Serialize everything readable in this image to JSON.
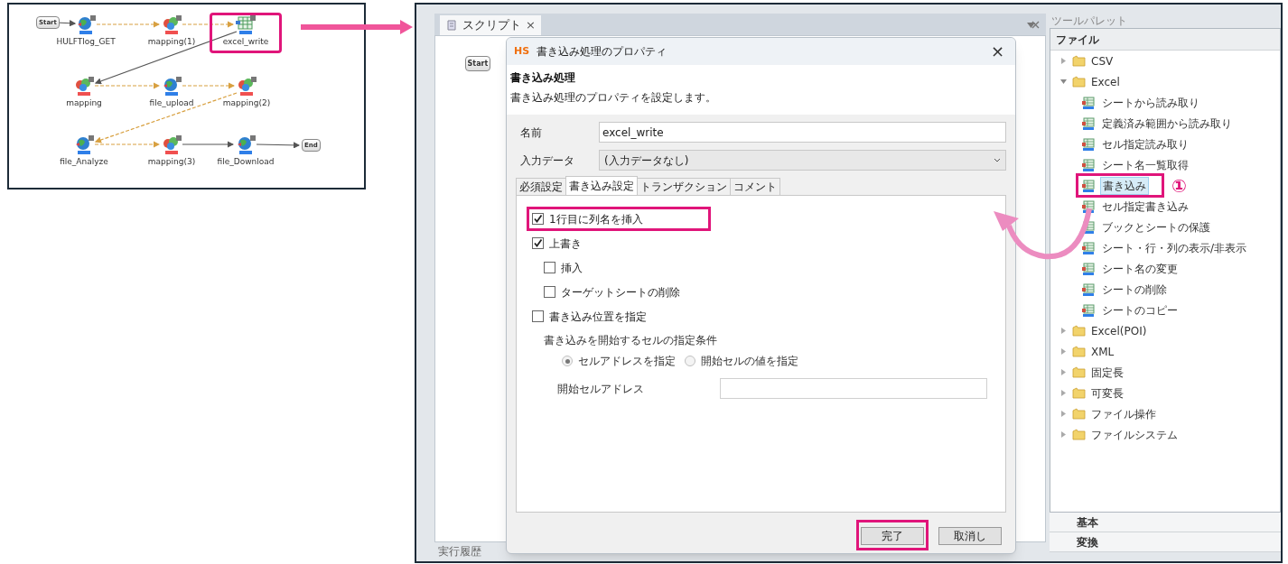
{
  "diagram": {
    "nodes": [
      {
        "label": "Start",
        "kind": "start",
        "highlighted": false
      },
      {
        "label": "HULFTlog_GET",
        "kind": "rest",
        "highlighted": false
      },
      {
        "label": "mapping(1)",
        "kind": "mapper",
        "highlighted": false
      },
      {
        "label": "excel_write",
        "kind": "excel",
        "highlighted": true
      },
      {
        "label": "mapping",
        "kind": "mapper",
        "highlighted": false
      },
      {
        "label": "file_upload",
        "kind": "rest",
        "highlighted": false
      },
      {
        "label": "mapping(2)",
        "kind": "mapper",
        "highlighted": false
      },
      {
        "label": "file_Analyze",
        "kind": "rest",
        "highlighted": false
      },
      {
        "label": "mapping(3)",
        "kind": "mapper",
        "highlighted": false
      },
      {
        "label": "file_Download",
        "kind": "rest",
        "highlighted": false
      },
      {
        "label": "End",
        "kind": "end",
        "highlighted": false
      }
    ]
  },
  "script_pane": {
    "tab": {
      "label": "スクリプト",
      "close": "×",
      "selected": true
    },
    "start_node": "Start",
    "bottom_tab": "実行履歴"
  },
  "dialog": {
    "logo": "HS",
    "title": "書き込み処理のプロパティ",
    "close": "×",
    "heading": "書き込み処理",
    "description": "書き込み処理のプロパティを設定します。",
    "fields": [
      {
        "label": "名前",
        "kind": "text",
        "value": "excel_write"
      },
      {
        "label": "入力データ",
        "kind": "select",
        "value": "(入力データなし)"
      }
    ],
    "tabs": [
      {
        "label": "必須設定",
        "selected": false
      },
      {
        "label": "書き込み設定",
        "selected": true
      },
      {
        "label": "トランザクション",
        "selected": false
      },
      {
        "label": "コメント",
        "selected": false
      }
    ],
    "checkboxes": [
      {
        "label": "1行目に列名を挿入",
        "checked": true,
        "highlighted": true
      },
      {
        "label": "上書き",
        "checked": true,
        "highlighted": false,
        "children": [
          {
            "label": "挿入",
            "checked": false,
            "highlighted": false
          },
          {
            "label": "ターゲットシートの削除",
            "checked": false,
            "highlighted": false
          }
        ]
      },
      {
        "label": "書き込み位置を指定",
        "checked": false,
        "highlighted": false
      }
    ],
    "condition": {
      "label": "書き込みを開始するセルの指定条件",
      "radios": [
        {
          "label": "セルアドレスを指定",
          "selected": true
        },
        {
          "label": "開始セルの値を指定",
          "selected": false
        }
      ]
    },
    "start_cell": {
      "label": "開始セルアドレス"
    },
    "buttons": [
      {
        "label": "完了",
        "highlighted": true
      },
      {
        "label": "取消し",
        "highlighted": false
      }
    ]
  },
  "palette": {
    "title": "ツールパレット",
    "section": "ファイル",
    "annotation": "①",
    "tree": [
      {
        "label": "CSV",
        "kind": "folder",
        "expanded": false
      },
      {
        "label": "Excel",
        "kind": "folder",
        "expanded": true,
        "children": [
          {
            "label": "シートから読み取り",
            "kind": "item",
            "selected": false,
            "highlighted": false
          },
          {
            "label": "定義済み範囲から読み取り",
            "kind": "item",
            "selected": false,
            "highlighted": false
          },
          {
            "label": "セル指定読み取り",
            "kind": "item",
            "selected": false,
            "highlighted": false
          },
          {
            "label": "シート名一覧取得",
            "kind": "item",
            "selected": false,
            "highlighted": false
          },
          {
            "label": "書き込み",
            "kind": "item",
            "selected": true,
            "highlighted": true
          },
          {
            "label": "セル指定書き込み",
            "kind": "item",
            "selected": false,
            "highlighted": false
          },
          {
            "label": "ブックとシートの保護",
            "kind": "item",
            "selected": false,
            "highlighted": false
          },
          {
            "label": "シート・行・列の表示/非表示",
            "kind": "item",
            "selected": false,
            "highlighted": false
          },
          {
            "label": "シート名の変更",
            "kind": "item",
            "selected": false,
            "highlighted": false
          },
          {
            "label": "シートの削除",
            "kind": "item",
            "selected": false,
            "highlighted": false
          },
          {
            "label": "シートのコピー",
            "kind": "item",
            "selected": false,
            "highlighted": false
          }
        ]
      },
      {
        "label": "Excel(POI)",
        "kind": "folder",
        "expanded": false
      },
      {
        "label": "XML",
        "kind": "folder",
        "expanded": false
      },
      {
        "label": "固定長",
        "kind": "folder",
        "expanded": false
      },
      {
        "label": "可変長",
        "kind": "folder",
        "expanded": false
      },
      {
        "label": "ファイル操作",
        "kind": "folder",
        "expanded": false
      },
      {
        "label": "ファイルシステム",
        "kind": "folder",
        "expanded": false
      }
    ],
    "categories": [
      "基本",
      "変換"
    ]
  }
}
